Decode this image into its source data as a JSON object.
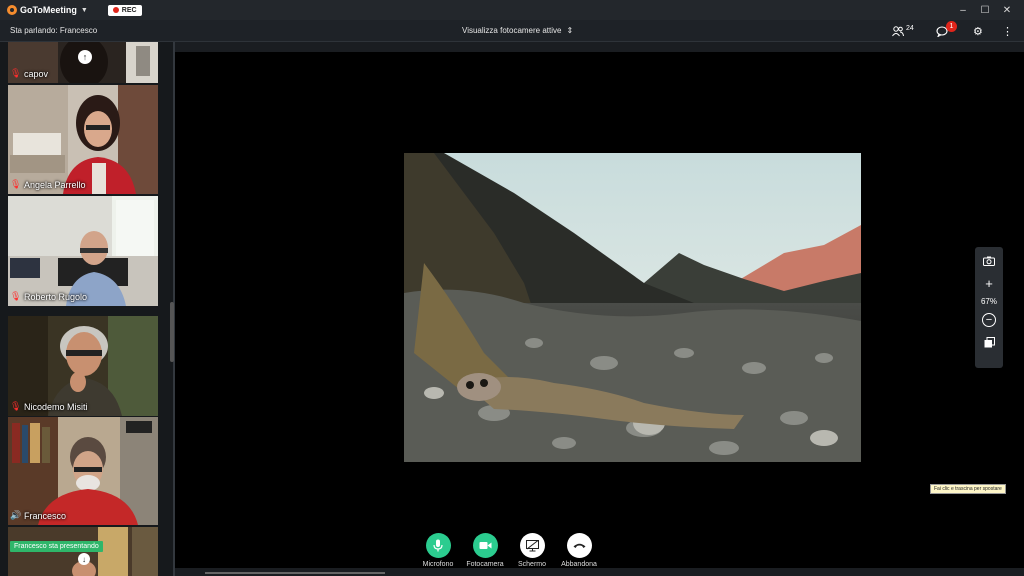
{
  "app": {
    "name": "GoToMeeting",
    "rec_label": "REC"
  },
  "toolbar": {
    "speaking": "Sta parlando: Francesco",
    "camera_selector": "Visualizza fotocamere attive",
    "attendee_count": "24",
    "chat_badge": "1"
  },
  "participants": [
    {
      "name": "capov",
      "mic": "muted"
    },
    {
      "name": "Angela Parrello",
      "mic": "muted"
    },
    {
      "name": "Roberto Rugolo",
      "mic": "muted"
    },
    {
      "name": "Nicodemo Misiti",
      "mic": "muted"
    },
    {
      "name": "Francesco",
      "mic": "on"
    }
  ],
  "presenting_label": "Francesco sta presentando",
  "zoom": {
    "value": "67%"
  },
  "tooltip": "Fai clic e trascina per spostare",
  "controls": {
    "mic": "Microfono",
    "camera": "Fotocamera",
    "screen": "Schermo",
    "leave": "Abbandona"
  },
  "colors": {
    "accent_green": "#2bcc8f",
    "muted_red": "#ff2d2d",
    "rec_red": "#e0251b"
  }
}
